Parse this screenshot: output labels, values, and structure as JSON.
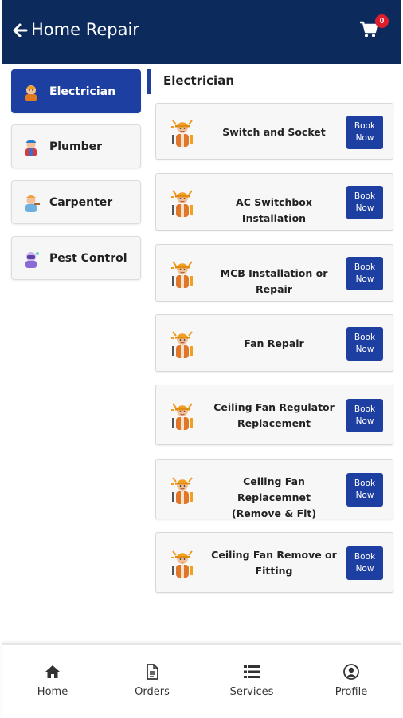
{
  "header": {
    "title": "Home Repair",
    "back_icon": "arrow-left-icon",
    "cart_icon": "cart-icon",
    "cart_count": "0"
  },
  "categories": [
    {
      "label": "Electrician",
      "active": true,
      "icon": "electrician-icon"
    },
    {
      "label": "Plumber",
      "active": false,
      "icon": "plumber-icon"
    },
    {
      "label": "Carpenter",
      "active": false,
      "icon": "carpenter-icon"
    },
    {
      "label": "Pest Control",
      "active": false,
      "icon": "pest-control-icon"
    }
  ],
  "section": {
    "title": "Electrician"
  },
  "services": [
    {
      "name_lines": [
        "Switch and Socket"
      ],
      "book_lines": [
        "Book",
        "Now"
      ]
    },
    {
      "name_lines": [
        "AC Switchbox Installation"
      ],
      "book_lines": [
        "Book",
        "Now"
      ]
    },
    {
      "name_lines": [
        "MCB Installation or Repair"
      ],
      "book_lines": [
        "Book",
        "Now"
      ]
    },
    {
      "name_lines": [
        "Fan Repair"
      ],
      "book_lines": [
        "Book",
        "Now"
      ]
    },
    {
      "name_lines": [
        "Ceiling Fan Regulator",
        "Replacement"
      ],
      "book_lines": [
        "Book",
        "Now"
      ]
    },
    {
      "name_lines": [
        "Ceiling Fan Replacemnet",
        "(Remove & Fit)"
      ],
      "book_lines": [
        "Book",
        "Now"
      ]
    },
    {
      "name_lines": [
        "Ceiling Fan Remove or",
        "Fitting"
      ],
      "book_lines": [
        "Book",
        "Now"
      ]
    }
  ],
  "bottom_nav": [
    {
      "label": "Home",
      "icon": "home-icon"
    },
    {
      "label": "Orders",
      "icon": "orders-icon"
    },
    {
      "label": "Services",
      "icon": "services-icon"
    },
    {
      "label": "Profile",
      "icon": "profile-icon"
    }
  ],
  "colors": {
    "header_bg": "#0d2a5c",
    "accent": "#1e3fa2",
    "badge": "#e11d2c"
  }
}
